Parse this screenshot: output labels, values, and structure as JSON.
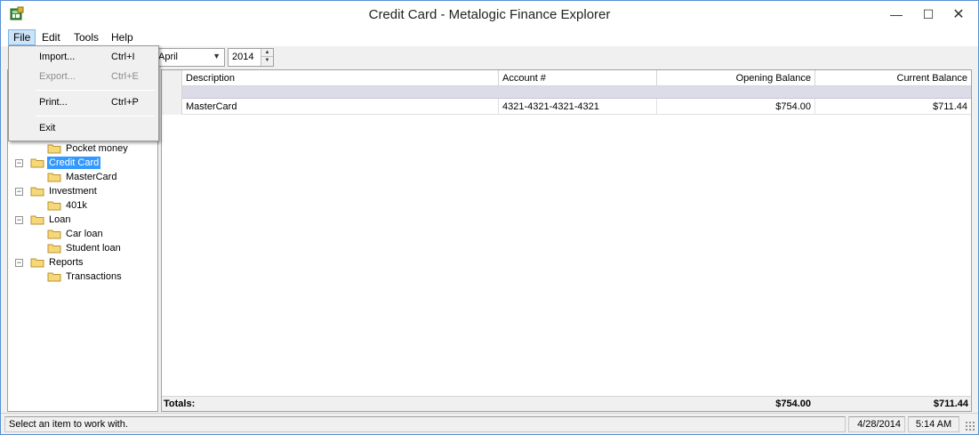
{
  "window": {
    "title": "Credit Card - Metalogic Finance Explorer",
    "min_glyph": "—",
    "max_glyph": "☐",
    "close_glyph": "✕"
  },
  "menubar": {
    "file": "File",
    "edit": "Edit",
    "tools": "Tools",
    "help": "Help"
  },
  "file_menu": {
    "items": [
      {
        "label": "Import...",
        "shortcut": "Ctrl+I",
        "enabled": true
      },
      {
        "label": "Export...",
        "shortcut": "Ctrl+E",
        "enabled": false
      },
      {
        "label": "Print...",
        "shortcut": "Ctrl+P",
        "enabled": true
      },
      {
        "label": "Exit",
        "shortcut": "",
        "enabled": true
      }
    ]
  },
  "toolbar": {
    "month": "April",
    "year": "2014"
  },
  "tree": {
    "items": [
      {
        "label": "Pocket money",
        "level": 1
      },
      {
        "label": "Credit Card",
        "level": 0,
        "expanded": true,
        "selected": true
      },
      {
        "label": "MasterCard",
        "level": 1
      },
      {
        "label": "Investment",
        "level": 0,
        "expanded": true
      },
      {
        "label": "401k",
        "level": 1
      },
      {
        "label": "Loan",
        "level": 0,
        "expanded": true
      },
      {
        "label": "Car loan",
        "level": 1
      },
      {
        "label": "Student loan",
        "level": 1
      },
      {
        "label": "Reports",
        "level": 0,
        "expanded": true
      },
      {
        "label": "Transactions",
        "level": 1
      }
    ],
    "expander_glyph": "−"
  },
  "grid": {
    "columns": [
      "Description",
      "Account #",
      "Opening Balance",
      "Current Balance"
    ],
    "rows": [
      {
        "description": "MasterCard",
        "account": "4321-4321-4321-4321",
        "opening": "$754.00",
        "current": "$711.44"
      }
    ],
    "totals_label": "Totals:",
    "totals_opening": "$754.00",
    "totals_current": "$711.44"
  },
  "statusbar": {
    "message": "Select an item to work with.",
    "date": "4/28/2014",
    "time": "5:14 AM"
  },
  "colors": {
    "selection": "#3399ff",
    "menu_active": "#cce4f7",
    "group_row": "#dcdce8"
  }
}
